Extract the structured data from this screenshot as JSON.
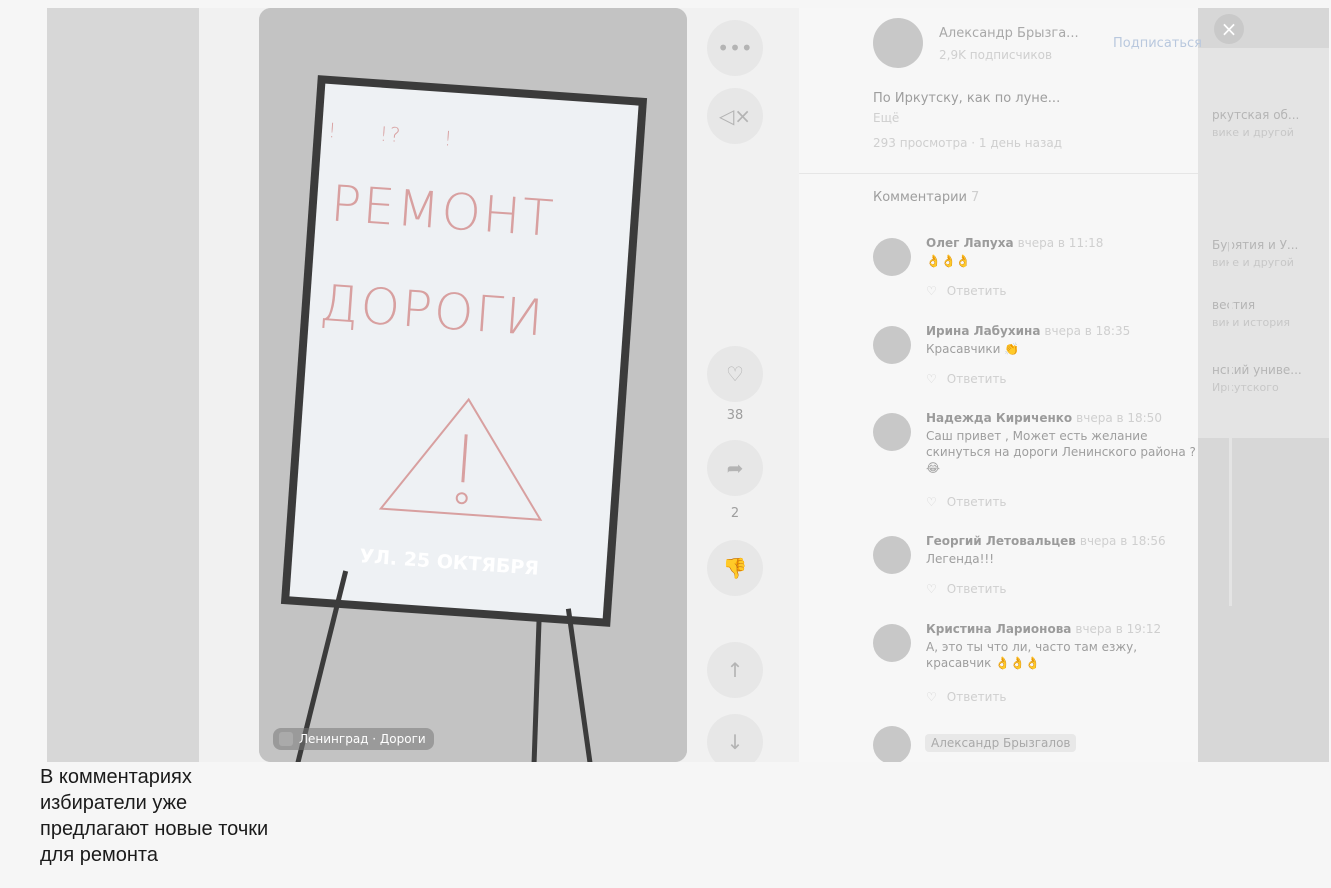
{
  "close_label": "×",
  "feed": [
    {
      "title": "ркутская об...",
      "sub": "вике и другой"
    },
    {
      "title": "Бурятия и У...",
      "sub": "вике и другой"
    },
    {
      "title": "вестия",
      "sub": "вики история"
    },
    {
      "title": "нский униве...",
      "sub": "Иркутского"
    }
  ],
  "video": {
    "board_line1": "РЕМОНТ",
    "board_line2": "ДОРОГИ",
    "board_caption": "УЛ. 25 ОКТЯБРЯ",
    "tag": "Ленинград · Дороги"
  },
  "actions": {
    "more_icon": "•••",
    "mute_icon": "◁×",
    "like_icon": "♡",
    "like_count": "38",
    "share_icon": "➦",
    "share_count": "2",
    "dislike_icon": "👎",
    "up_icon": "↑",
    "down_icon": "↓"
  },
  "author": {
    "name": "Александр Брызга...",
    "subs": "2,9K подписчиков",
    "subscribe": "Подписаться"
  },
  "post": {
    "description": "По Иркутску, как по луне...",
    "more": "Ещё",
    "views": "293 просмотра · 1 день назад"
  },
  "comments_title": "Комментарии",
  "comments_count": "7",
  "reply_label": "Ответить",
  "comments": [
    {
      "author": "Олег Лапуха",
      "time": "вчера в 11:18",
      "text": "👌👌👌"
    },
    {
      "author": "Ирина Лабухина",
      "time": "вчера в 18:35",
      "text": "Красавчики 👏"
    },
    {
      "author": "Надежда Кириченко",
      "time": "вчера в 18:50",
      "text": "Саш привет , Может есть желание скинуться на дороги Ленинского района ? 😂"
    },
    {
      "author": "Георгий Летовальцев",
      "time": "вчера в 18:56",
      "text": "Легенда!!!"
    },
    {
      "author": "Кристина Ларионова",
      "time": "вчера в 19:12",
      "text": "А, это ты что ли, часто там езжу, красавчик 👌👌👌"
    }
  ],
  "author_chip": "Александр Брызгалов",
  "caption": "В комментариях избиратели уже предлагают новые точки для ремонта"
}
